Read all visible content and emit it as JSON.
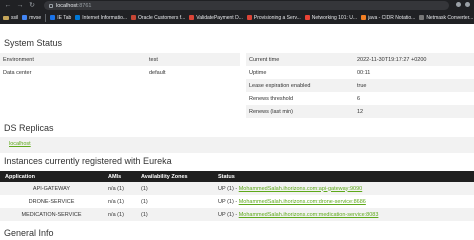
{
  "browser": {
    "url_host": "localhost",
    "url_port": ":8761",
    "bookmarks": [
      {
        "label": "ssil",
        "color": "#f4b400",
        "folder": true
      },
      {
        "label": "mvse",
        "color": "#4285f4",
        "folder": false
      },
      {
        "label": "IE Tab",
        "color": "#1a73e8",
        "folder": false
      },
      {
        "label": "Internet Informatio...",
        "color": "#0078d7",
        "folder": false
      },
      {
        "label": "Oracle Customers f...",
        "color": "#c74634",
        "folder": false
      },
      {
        "label": "ValidatePayment D...",
        "color": "#db4437",
        "folder": false
      },
      {
        "label": "Provisioning a Serv...",
        "color": "#db4437",
        "folder": false
      },
      {
        "label": "Networking 101: U...",
        "color": "#ea4335",
        "folder": false
      },
      {
        "label": "java - CIDR Notatio...",
        "color": "#f48024",
        "folder": false
      },
      {
        "label": "Netmask Converter...",
        "color": "#777777",
        "folder": false
      }
    ]
  },
  "system_status": {
    "title": "System Status",
    "left": [
      {
        "key": "Environment",
        "value": "test"
      },
      {
        "key": "Data center",
        "value": "default"
      }
    ],
    "right": [
      {
        "key": "Current time",
        "value": "2022-11-30T19:17:27 +0200"
      },
      {
        "key": "Uptime",
        "value": "00:11"
      },
      {
        "key": "Lease expiration enabled",
        "value": "true"
      },
      {
        "key": "Renews threshold",
        "value": "6"
      },
      {
        "key": "Renews (last min)",
        "value": "12"
      }
    ]
  },
  "replicas": {
    "title": "DS Replicas",
    "items": [
      "localhost"
    ]
  },
  "instances": {
    "title": "Instances currently registered with Eureka",
    "columns": [
      "Application",
      "AMIs",
      "Availability Zones",
      "Status"
    ],
    "rows": [
      {
        "application": "API-GATEWAY",
        "amis": "n/a (1)",
        "zones": "(1)",
        "status_prefix": "UP (1) - ",
        "status_link": "MohammedSalah.ihorizons.com:api-gateway:9090"
      },
      {
        "application": "DRONE-SERVICE",
        "amis": "n/a (1)",
        "zones": "(1)",
        "status_prefix": "UP (1) - ",
        "status_link": "MohammedSalah.ihorizons.com:drone-service:8686"
      },
      {
        "application": "MEDICATION-SERVICE",
        "amis": "n/a (1)",
        "zones": "(1)",
        "status_prefix": "UP (1) - ",
        "status_link": "MohammedSalah.ihorizons.com:medication-service:8083"
      }
    ]
  },
  "general_info": {
    "title": "General Info"
  }
}
